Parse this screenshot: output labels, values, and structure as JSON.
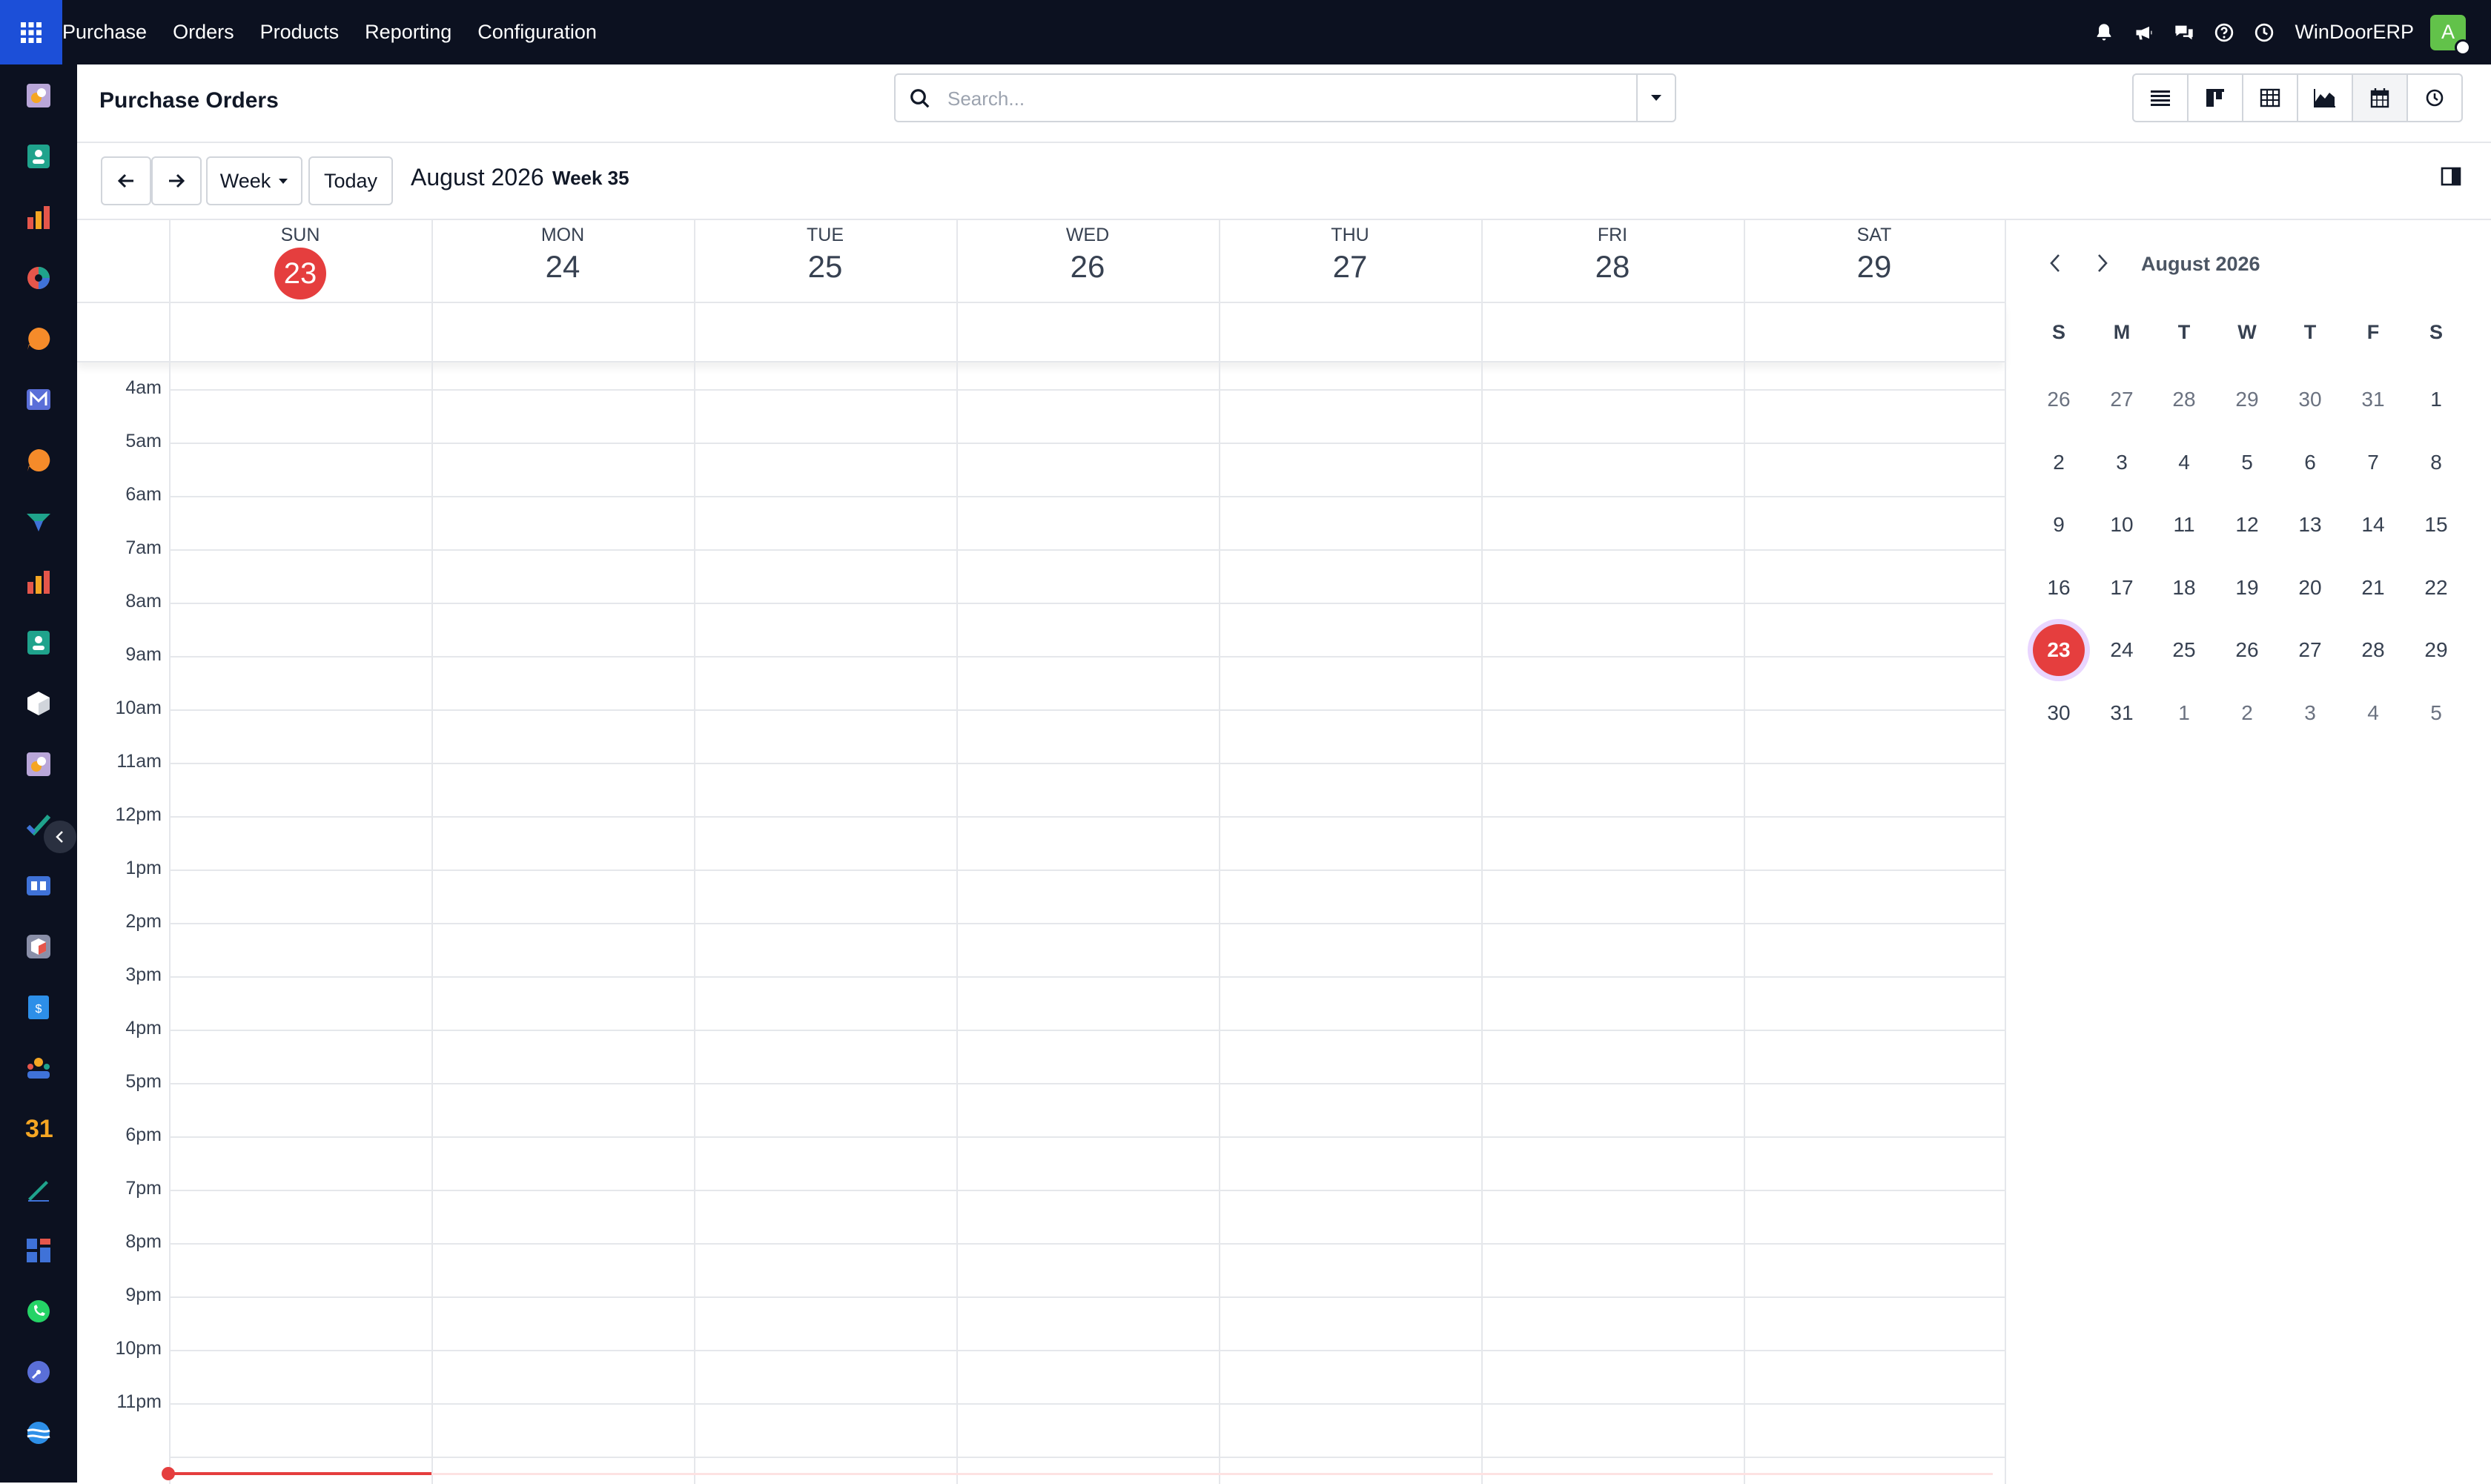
{
  "topbar": {
    "apps_icon": "grid-icon",
    "menu": [
      "Purchase",
      "Orders",
      "Products",
      "Reporting",
      "Configuration"
    ],
    "company": "WinDoorERP",
    "avatar_letter": "A",
    "icons": [
      "bell-icon",
      "megaphone-icon",
      "chat-icon",
      "help-icon",
      "clock-icon"
    ]
  },
  "sidebar": {
    "apps": [
      "purchase-app-icon",
      "contacts-app-icon",
      "sales-app-icon",
      "dashboard-app-icon",
      "discuss-app-icon",
      "email-marketing-app-icon",
      "live-chat-app-icon",
      "crm-app-icon",
      "reporting-app-icon",
      "employees-app-icon",
      "inventory-app-icon",
      "purchase-app-icon",
      "project-app-icon",
      "knowledge-app-icon",
      "product-app-icon",
      "invoicing-app-icon",
      "team-app-icon",
      "calendar-app-icon",
      "sign-app-icon",
      "dashboards-app-icon",
      "whatsapp-app-icon",
      "time-off-app-icon",
      "website-app-icon"
    ],
    "calendar_icon_text": "31"
  },
  "control": {
    "title": "Purchase Orders",
    "search_placeholder": "Search...",
    "views": [
      "list-view-icon",
      "kanban-view-icon",
      "pivot-view-icon",
      "graph-view-icon",
      "calendar-view-icon",
      "activity-view-icon"
    ],
    "active_view": "calendar-view-icon"
  },
  "calendar_nav": {
    "scale_label": "Week",
    "today_label": "Today",
    "range_label": "August 2026",
    "week_label": "Week 35"
  },
  "week": {
    "days": [
      {
        "name": "SUN",
        "num": "23",
        "today": true
      },
      {
        "name": "MON",
        "num": "24"
      },
      {
        "name": "TUE",
        "num": "25"
      },
      {
        "name": "WED",
        "num": "26"
      },
      {
        "name": "THU",
        "num": "27"
      },
      {
        "name": "FRI",
        "num": "28"
      },
      {
        "name": "SAT",
        "num": "29"
      }
    ],
    "hours": [
      "4am",
      "5am",
      "6am",
      "7am",
      "8am",
      "9am",
      "10am",
      "11am",
      "12pm",
      "1pm",
      "2pm",
      "3pm",
      "4pm",
      "5pm",
      "6pm",
      "7pm",
      "8pm",
      "9pm",
      "10pm",
      "11pm"
    ]
  },
  "mini_calendar": {
    "title": "August 2026",
    "weekdays": [
      "S",
      "M",
      "T",
      "W",
      "T",
      "F",
      "S"
    ],
    "weeks": [
      [
        "26",
        "27",
        "28",
        "29",
        "30",
        "31",
        "1"
      ],
      [
        "2",
        "3",
        "4",
        "5",
        "6",
        "7",
        "8"
      ],
      [
        "9",
        "10",
        "11",
        "12",
        "13",
        "14",
        "15"
      ],
      [
        "16",
        "17",
        "18",
        "19",
        "20",
        "21",
        "22"
      ],
      [
        "23",
        "24",
        "25",
        "26",
        "27",
        "28",
        "29"
      ],
      [
        "30",
        "31",
        "1",
        "2",
        "3",
        "4",
        "5"
      ]
    ],
    "today": "23"
  },
  "colors": {
    "today": "#e53e3e",
    "topbar": "#0c1120",
    "apps_button": "#1c4fd8"
  }
}
